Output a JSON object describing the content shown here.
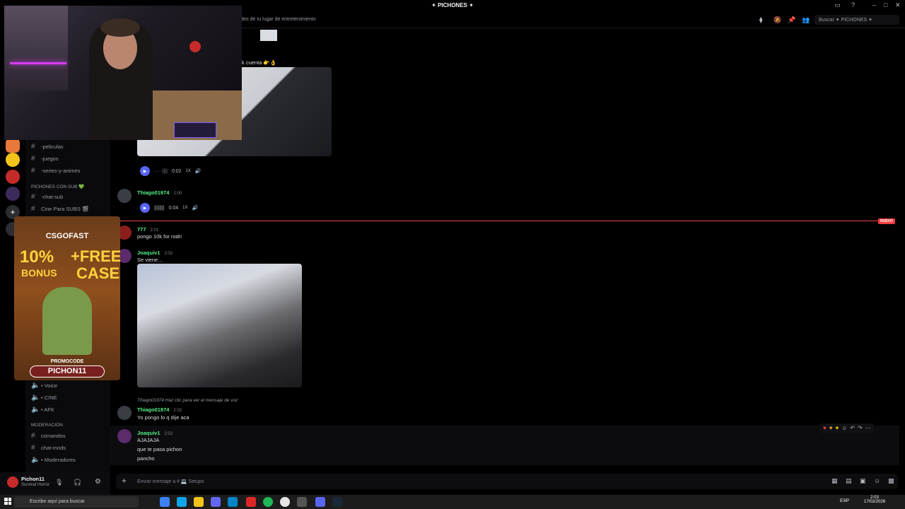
{
  "window": {
    "title": "✦ PICHONES ✦"
  },
  "topbar": {
    "topic": "deo de tu lugar de entretenimiento",
    "search_placeholder": "Buscar ✦ PICHONES ✦"
  },
  "sidebar": {
    "channels_top": [
      "-peliculas",
      "-juegos",
      "-series-y-animes"
    ],
    "category_sub": "PICHONES CON SUB 💚",
    "channels_sub": [
      "-chat-sub",
      "Cine Para SUBS 🎬"
    ],
    "voice_channels": [
      "• Voice",
      "• CINE",
      "• AFK"
    ],
    "category_mod": "MODERACIÓN",
    "mod_channels": [
      "comandos",
      "chat-mods",
      "• Moderadores"
    ]
  },
  "user": {
    "name": "Pichon11",
    "status": "Survival Horror"
  },
  "messages": {
    "early_text": "k cuenta 👉👌",
    "voice1": {
      "time": "0:02",
      "speed": "1X"
    },
    "thiago1": {
      "author": "Thiago01974",
      "ts": "2:00"
    },
    "voice2": {
      "time": "0:04",
      "speed": "1X"
    },
    "new_label": "NUEVO",
    "m777": {
      "author": "777",
      "ts": "2:01",
      "text": "pongo 10k for rodri"
    },
    "joaquiv1": {
      "author": "Joaquiv1",
      "ts": "2:02",
      "text": "Se viene..."
    },
    "reply_ref": "Thiago01974 Haz clic para ver el mensaje de voz",
    "thiago2": {
      "author": "Thiago01974",
      "ts": "2:02",
      "text": "Yo pongo lo q dije aca"
    },
    "joaquiv2": {
      "author": "Joaquiv1",
      "ts": "2:02",
      "lines": [
        "AJAJAJA",
        "que te pasa pichon",
        "pancho"
      ]
    }
  },
  "composer": {
    "placeholder": "Enviar mensaje a # 💻 Setups"
  },
  "ad": {
    "brand": "CSGOFAST",
    "bonus": "10%",
    "bonus_label": "BONUS",
    "free": "+FREE",
    "case": "CASE",
    "promo_label": "PROMOCODE",
    "code": "PICHON11"
  },
  "taskbar": {
    "search_placeholder": "Escribe aquí para buscar",
    "lang": "ESP",
    "time": "2:03",
    "date": "17/02/2026"
  },
  "colors": {
    "accent": "#5865f2",
    "new_line": "#f23f43",
    "username_green": "#57f287"
  }
}
